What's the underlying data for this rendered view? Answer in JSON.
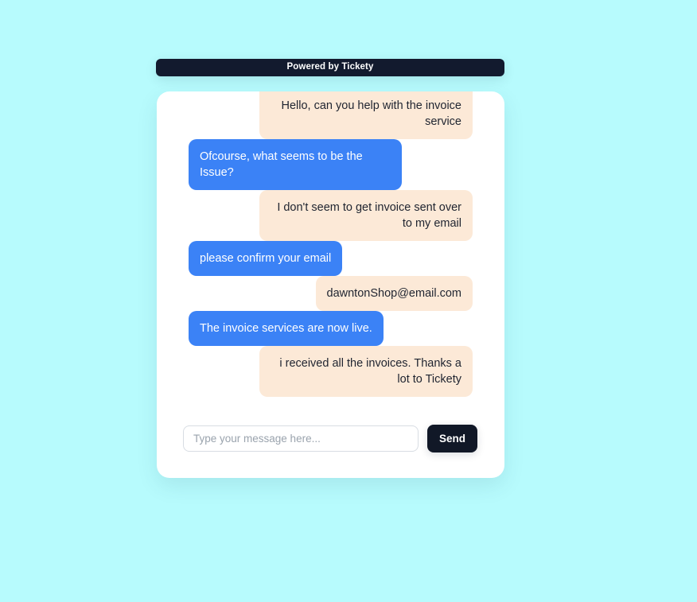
{
  "header": {
    "brand_label": "Powered by Tickety",
    "background_color": "#121a2e",
    "text_color": "#ffffff"
  },
  "page": {
    "background_color": "#b7fbfd",
    "card_background": "#ffffff"
  },
  "chat": {
    "agent_bubble_color": "#3b82f6",
    "agent_text_color": "#ffffff",
    "user_bubble_color": "#fce9d7",
    "user_text_color": "#1f2430",
    "messages": [
      {
        "sender": "user",
        "text": "Hello, can you help with the invoice service",
        "clipped": true
      },
      {
        "sender": "agent",
        "text": "Ofcourse, what seems to be the Issue?",
        "clipped": false
      },
      {
        "sender": "user",
        "text": "I don't seem to get invoice sent over to my email",
        "clipped": false
      },
      {
        "sender": "agent",
        "text": "please confirm your email",
        "clipped": false
      },
      {
        "sender": "user",
        "text": "dawntonShop@email.com",
        "clipped": false
      },
      {
        "sender": "agent",
        "text": "The invoice services are now live.",
        "clipped": false
      },
      {
        "sender": "user",
        "text": "i received all the invoices. Thanks a lot to Tickety",
        "clipped": false
      }
    ]
  },
  "composer": {
    "input_value": "",
    "input_placeholder": "Type your message here...",
    "send_label": "Send",
    "send_background": "#111827"
  }
}
